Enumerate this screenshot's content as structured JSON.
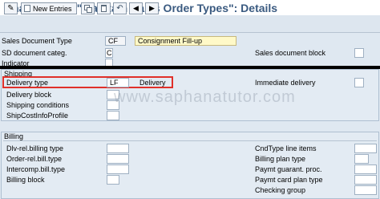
{
  "title": "Change View \"Maintain Sales Order Types\": Details",
  "toolbar": {
    "new_entries_label": "New Entries"
  },
  "header": {
    "sales_doc_type_label": "Sales Document Type",
    "sales_doc_type_value": "CF",
    "sales_doc_type_desc": "Consignment Fill-up",
    "sd_doc_categ_label": "SD document categ.",
    "sd_doc_categ_value": "C",
    "sales_doc_block_label": "Sales document block",
    "indicator_label": "Indicator"
  },
  "shipping": {
    "title": "Shipping",
    "delivery_type_label": "Delivery type",
    "delivery_type_value": "LF",
    "delivery_type_desc": "Delivery",
    "immediate_delivery_label": "Immediate delivery",
    "delivery_block_label": "Delivery block",
    "shipping_conditions_label": "Shipping conditions",
    "ship_cost_info_label": "ShipCostInfoProfile"
  },
  "billing": {
    "title": "Billing",
    "dlv_rel_billing_label": "Dlv-rel.billing type",
    "cndtype_line_items_label": "CndType line items",
    "order_rel_bill_label": "Order-rel.bill.type",
    "billing_plan_type_label": "Billing plan type",
    "intercomp_bill_label": "Intercomp.bill.type",
    "paymt_guarant_label": "Paymt guarant. proc.",
    "billing_block_label": "Billing block",
    "paymt_card_plan_label": "Paymt card plan type",
    "checking_group_label": "Checking group"
  },
  "watermark": "www.saphanatutor.com",
  "colors": {
    "title": "#3a5a80",
    "highlight": "#e0302a",
    "background": "#dfe8f1",
    "desc_field": "#fff9c8"
  }
}
